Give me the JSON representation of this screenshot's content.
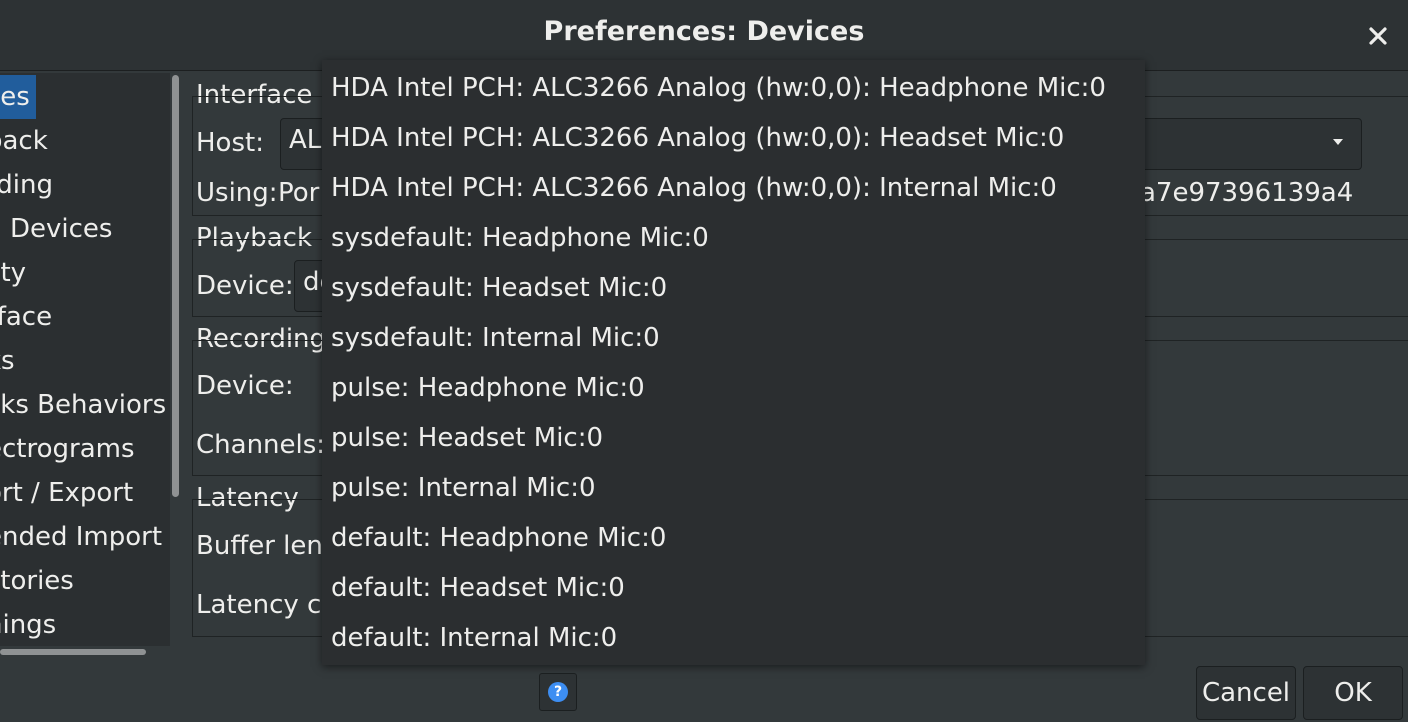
{
  "window": {
    "title": "Preferences: Devices",
    "close_icon": "✕"
  },
  "sidebar": {
    "items": [
      {
        "label": "ces",
        "selected": true
      },
      {
        "label": "back"
      },
      {
        "label": "rding"
      },
      {
        "label": "Devices"
      },
      {
        "label": "lity"
      },
      {
        "label": "rface"
      },
      {
        "label": "ks"
      },
      {
        "label": "cks Behaviors"
      },
      {
        "label": "ectrograms"
      },
      {
        "label": "ort / Export"
      },
      {
        "label": "ended Import"
      },
      {
        "label": "ctories"
      },
      {
        "label": "nings"
      }
    ]
  },
  "interface": {
    "heading": "Interface",
    "host_label": "Host:",
    "host_value": "ALS",
    "using_label": "Using:",
    "using_value_left": "Por",
    "using_value_right": "a7e97396139a4"
  },
  "playback": {
    "heading": "Playback",
    "device_label": "Device:",
    "device_value": "de"
  },
  "recording": {
    "heading": "Recording",
    "device_label": "Device:",
    "channels_label": "Channels:"
  },
  "latency": {
    "heading": "Latency",
    "buffer_label": "Buffer len",
    "comp_label": "Latency co"
  },
  "dropdown": {
    "options": [
      "HDA Intel PCH: ALC3266 Analog (hw:0,0): Headphone Mic:0",
      "HDA Intel PCH: ALC3266 Analog (hw:0,0): Headset Mic:0",
      "HDA Intel PCH: ALC3266 Analog (hw:0,0): Internal Mic:0",
      "sysdefault: Headphone Mic:0",
      "sysdefault: Headset Mic:0",
      "sysdefault: Internal Mic:0",
      "pulse: Headphone Mic:0",
      "pulse: Headset Mic:0",
      "pulse: Internal Mic:0",
      "default: Headphone Mic:0",
      "default: Headset Mic:0",
      "default: Internal Mic:0"
    ]
  },
  "buttons": {
    "help": "?",
    "cancel": "Cancel",
    "ok": "OK"
  },
  "colors": {
    "background": "#33393b",
    "selection": "#215d9c",
    "help_accent": "#3d8ef2"
  }
}
